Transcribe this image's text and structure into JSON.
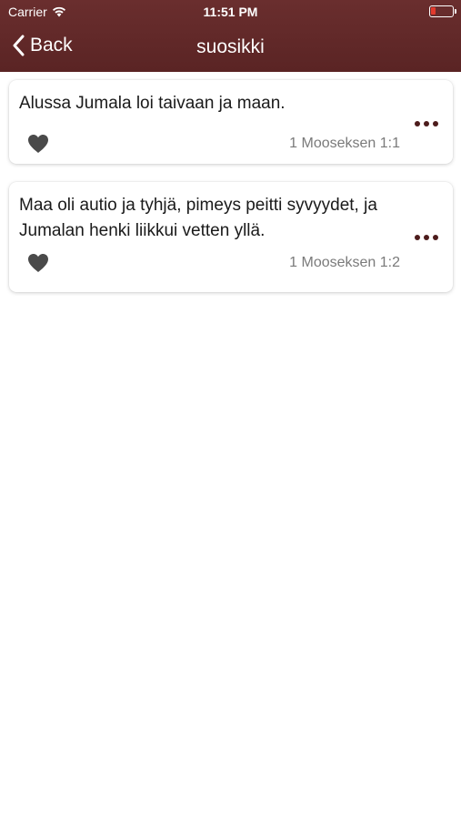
{
  "status_bar": {
    "carrier": "Carrier",
    "time": "11:51 PM",
    "battery_color": "#e23a2d"
  },
  "nav": {
    "back_label": "Back",
    "title": "suosikki",
    "bar_color": "#5e2828"
  },
  "favorites": [
    {
      "text": "Alussa Jumala loi taivaan ja maan.",
      "reference": "1 Mooseksen 1:1",
      "heart_icon": "heart-icon",
      "more_icon": "ellipsis-icon"
    },
    {
      "text": "Maa oli autio ja tyhjä, pimeys peitti syvyydet, ja Jumalan henki liikkui vetten yllä.",
      "reference": "1 Mooseksen 1:2",
      "heart_icon": "heart-icon",
      "more_icon": "ellipsis-icon"
    }
  ]
}
